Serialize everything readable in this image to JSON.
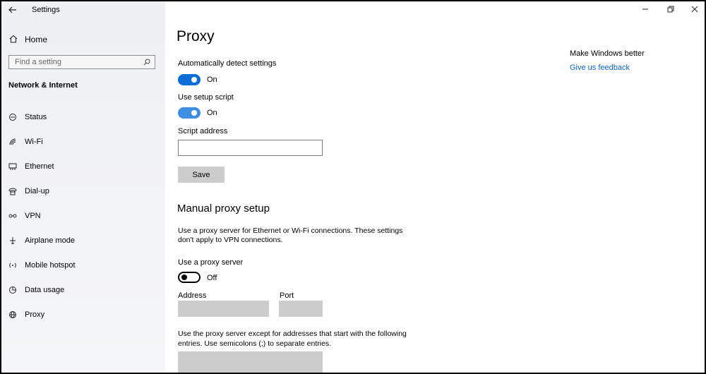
{
  "window": {
    "title": "Settings"
  },
  "sidebar": {
    "home_label": "Home",
    "search_placeholder": "Find a setting",
    "section_title": "Network & Internet",
    "items": [
      {
        "label": "Status",
        "icon": "status-icon"
      },
      {
        "label": "Wi-Fi",
        "icon": "wifi-icon"
      },
      {
        "label": "Ethernet",
        "icon": "ethernet-icon"
      },
      {
        "label": "Dial-up",
        "icon": "dialup-icon"
      },
      {
        "label": "VPN",
        "icon": "vpn-icon"
      },
      {
        "label": "Airplane mode",
        "icon": "airplane-icon"
      },
      {
        "label": "Mobile hotspot",
        "icon": "hotspot-icon"
      },
      {
        "label": "Data usage",
        "icon": "data-usage-icon"
      },
      {
        "label": "Proxy",
        "icon": "globe-icon"
      }
    ]
  },
  "main": {
    "title": "Proxy",
    "auto_detect": {
      "label": "Automatically detect settings",
      "state": "On"
    },
    "setup_script": {
      "label": "Use setup script",
      "state": "On"
    },
    "script_address": {
      "label": "Script address",
      "value": ""
    },
    "save_label": "Save",
    "manual": {
      "heading": "Manual proxy setup",
      "description_line1": "Use a proxy server for Ethernet or Wi-Fi connections. These settings",
      "description_line2": "don't apply to VPN connections.",
      "use_proxy": {
        "label": "Use a proxy server",
        "state": "Off"
      },
      "address_label": "Address",
      "address_value": "",
      "port_label": "Port",
      "port_value": "",
      "exceptions_line1": "Use the proxy server except for addresses that start with the following",
      "exceptions_line2": "entries. Use semicolons (;) to separate entries.",
      "exceptions_value": ""
    }
  },
  "right_panel": {
    "heading": "Make Windows better",
    "feedback_link": "Give us feedback"
  },
  "colors": {
    "accent": "#0c6dd6",
    "link": "#0b63c4",
    "disabled_field": "#cccccc"
  }
}
